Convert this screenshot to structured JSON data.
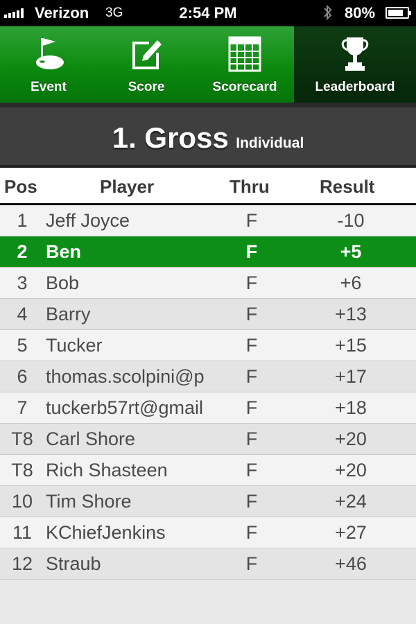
{
  "status_bar": {
    "carrier": "Verizon",
    "network": "3G",
    "time": "2:54 PM",
    "battery": "80%",
    "battery_level": 0.8
  },
  "tabs": [
    {
      "label": "Event",
      "icon": "flag-on-green-icon"
    },
    {
      "label": "Score",
      "icon": "edit-icon"
    },
    {
      "label": "Scorecard",
      "icon": "grid-icon"
    },
    {
      "label": "Leaderboard",
      "icon": "trophy-icon",
      "selected": true
    }
  ],
  "banner": {
    "title": "1. Gross",
    "subtitle": "Individual"
  },
  "table": {
    "headers": {
      "pos": "Pos",
      "player": "Player",
      "thru": "Thru",
      "result": "Result"
    },
    "rows": [
      {
        "pos": "1",
        "player": "Jeff Joyce",
        "thru": "F",
        "result": "-10"
      },
      {
        "pos": "2",
        "player": "Ben",
        "thru": "F",
        "result": "+5"
      },
      {
        "pos": "3",
        "player": "Bob",
        "thru": "F",
        "result": "+6"
      },
      {
        "pos": "4",
        "player": "Barry",
        "thru": "F",
        "result": "+13"
      },
      {
        "pos": "5",
        "player": "Tucker",
        "thru": "F",
        "result": "+15"
      },
      {
        "pos": "6",
        "player": "thomas.scolpini@p",
        "thru": "F",
        "result": "+17"
      },
      {
        "pos": "7",
        "player": "tuckerb57rt@gmail",
        "thru": "F",
        "result": "+18"
      },
      {
        "pos": "T8",
        "player": "Carl Shore",
        "thru": "F",
        "result": "+20"
      },
      {
        "pos": "T8",
        "player": "Rich Shasteen",
        "thru": "F",
        "result": "+20"
      },
      {
        "pos": "10",
        "player": "Tim Shore",
        "thru": "F",
        "result": "+24"
      },
      {
        "pos": "11",
        "player": "KChiefJenkins",
        "thru": "F",
        "result": "+27"
      },
      {
        "pos": "12",
        "player": "Straub",
        "thru": "F",
        "result": "+46"
      }
    ]
  },
  "colors": {
    "accent_green": "#0d8f17",
    "tab_bar_green": "#0b8a0d",
    "banner_gray": "#3f3f3f"
  }
}
